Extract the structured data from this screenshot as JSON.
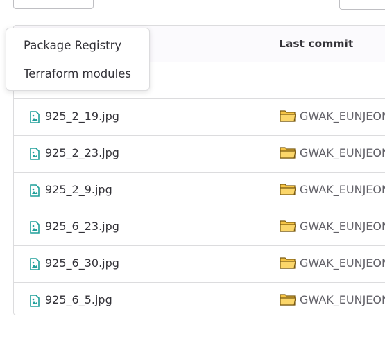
{
  "table": {
    "header": {
      "last_commit_label": "Last commit"
    },
    "rows": [
      {
        "name": "925_2_19.jpg",
        "commit": "GWAK_EUNJEONG"
      },
      {
        "name": "925_2_23.jpg",
        "commit": "GWAK_EUNJEONG"
      },
      {
        "name": "925_2_9.jpg",
        "commit": "GWAK_EUNJEONG"
      },
      {
        "name": "925_6_23.jpg",
        "commit": "GWAK_EUNJEONG"
      },
      {
        "name": "925_6_30.jpg",
        "commit": "GWAK_EUNJEONG"
      },
      {
        "name": "925_6_5.jpg",
        "commit": "GWAK_EUNJEONG"
      }
    ]
  },
  "dropdown": {
    "items": [
      {
        "label": "Package Registry"
      },
      {
        "label": "Terraform modules"
      }
    ]
  },
  "icons": {
    "file": "image-file-icon",
    "commit": "folder-icon"
  },
  "colors": {
    "file_icon": "#1f9f9a",
    "folder_fill": "#f6c445",
    "folder_stroke": "#7a5a12"
  }
}
